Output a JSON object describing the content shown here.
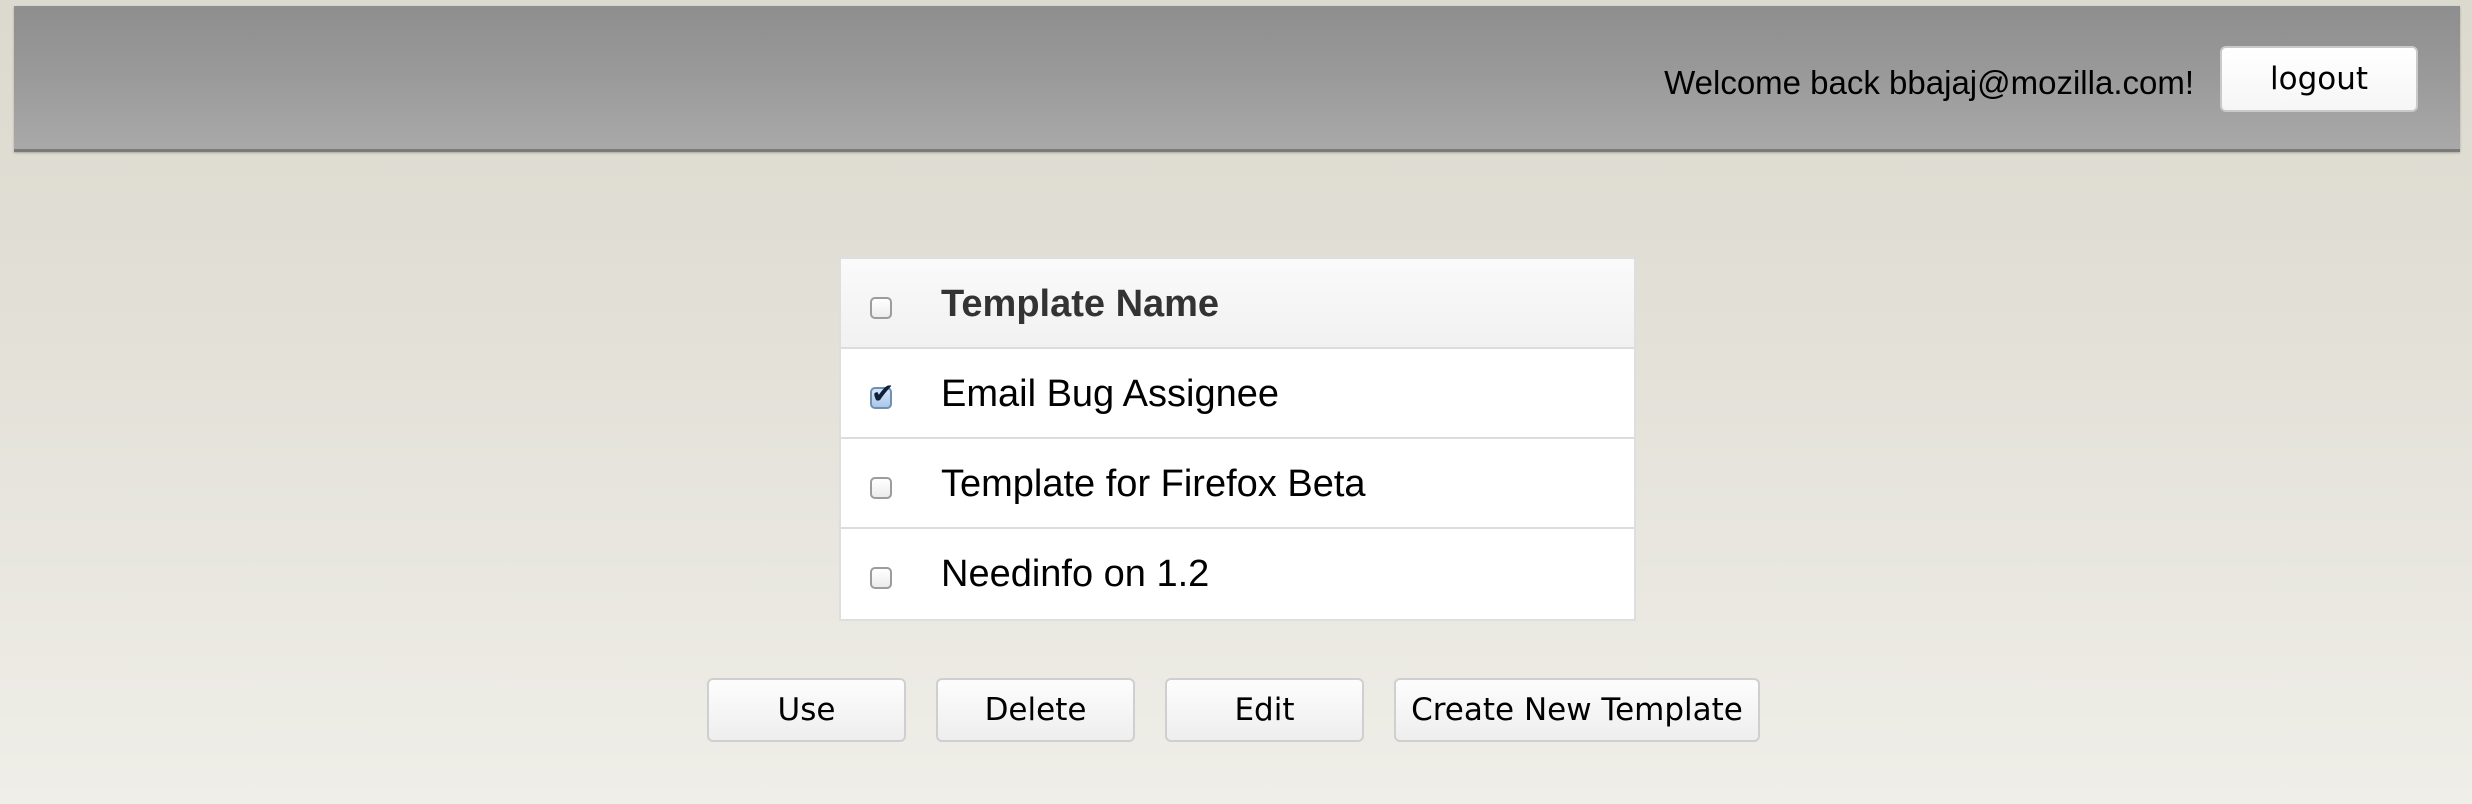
{
  "header": {
    "welcome_text": "Welcome back bbajaj@mozilla.com!",
    "logout_label": "logout"
  },
  "table": {
    "header_label": "Template Name",
    "header_checked": false,
    "rows": [
      {
        "name": "Email Bug Assignee",
        "checked": true
      },
      {
        "name": "Template for Firefox Beta",
        "checked": false
      },
      {
        "name": "Needinfo on 1.2",
        "checked": false
      }
    ]
  },
  "actions": {
    "use_label": "Use",
    "delete_label": "Delete",
    "edit_label": "Edit",
    "create_label": "Create New Template"
  },
  "icons": {
    "checkmark": "✔"
  }
}
